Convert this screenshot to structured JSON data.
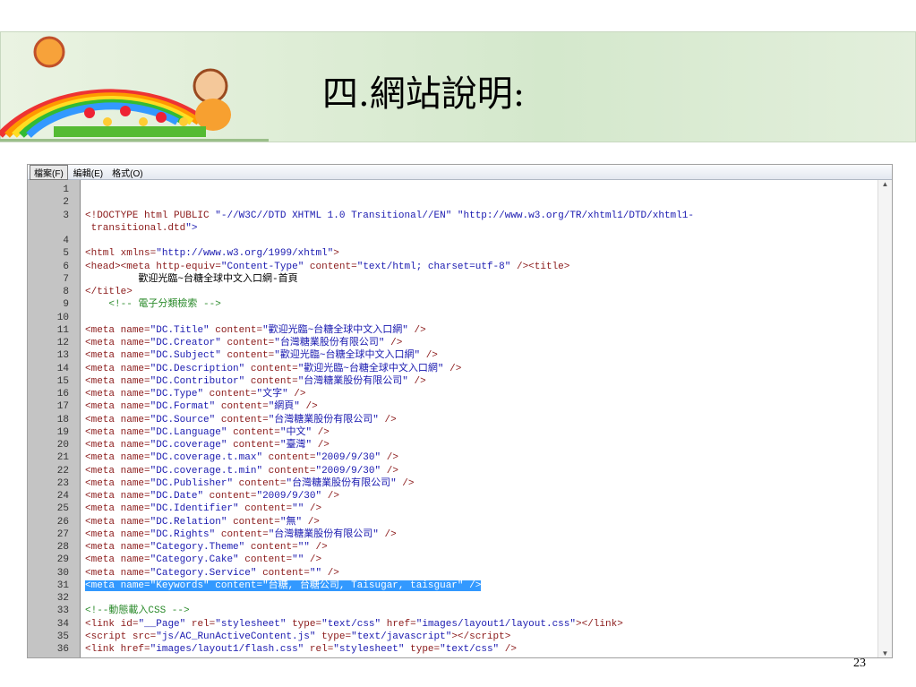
{
  "slide": {
    "title": "四.網站說明:",
    "page_number": "23"
  },
  "editor": {
    "menu": [
      {
        "label": "檔案(F)"
      },
      {
        "label": "編輯(E)"
      },
      {
        "label": "格式(O)"
      }
    ],
    "selected_line": "31",
    "lines": [
      {
        "n": "1",
        "t": ""
      },
      {
        "n": "2",
        "t": ""
      },
      {
        "n": "3",
        "t": "<!DOCTYPE html PUBLIC \"-//W3C//DTD XHTML 1.0 Transitional//EN\" \"http://www.w3.org/TR/xhtml1/DTD/xhtml1-"
      },
      {
        "n": "",
        "t": " transitional.dtd\">"
      },
      {
        "n": "4",
        "t": ""
      },
      {
        "n": "5",
        "t": "<html xmlns=\"http://www.w3.org/1999/xhtml\">"
      },
      {
        "n": "6",
        "t": "<head><meta http-equiv=\"Content-Type\" content=\"text/html; charset=utf-8\" /><title>"
      },
      {
        "n": "7",
        "t": "         歡迎光臨~台糖全球中文入口網-首頁"
      },
      {
        "n": "8",
        "t": "</title>"
      },
      {
        "n": "9",
        "t": "    <!-- 電子分類檢索 -->"
      },
      {
        "n": "10",
        "t": ""
      },
      {
        "n": "11",
        "t": "<meta name=\"DC.Title\" content=\"歡迎光臨~台糖全球中文入口網\" />"
      },
      {
        "n": "12",
        "t": "<meta name=\"DC.Creator\" content=\"台灣糖業股份有限公司\" />"
      },
      {
        "n": "13",
        "t": "<meta name=\"DC.Subject\" content=\"歡迎光臨~台糖全球中文入口網\" />"
      },
      {
        "n": "14",
        "t": "<meta name=\"DC.Description\" content=\"歡迎光臨~台糖全球中文入口網\" />"
      },
      {
        "n": "15",
        "t": "<meta name=\"DC.Contributor\" content=\"台灣糖業股份有限公司\" />"
      },
      {
        "n": "16",
        "t": "<meta name=\"DC.Type\" content=\"文字\" />"
      },
      {
        "n": "17",
        "t": "<meta name=\"DC.Format\" content=\"網頁\" />"
      },
      {
        "n": "18",
        "t": "<meta name=\"DC.Source\" content=\"台灣糖業股份有限公司\" />"
      },
      {
        "n": "19",
        "t": "<meta name=\"DC.Language\" content=\"中文\" />"
      },
      {
        "n": "20",
        "t": "<meta name=\"DC.coverage\" content=\"臺灣\" />"
      },
      {
        "n": "21",
        "t": "<meta name=\"DC.coverage.t.max\" content=\"2009/9/30\" />"
      },
      {
        "n": "22",
        "t": "<meta name=\"DC.coverage.t.min\" content=\"2009/9/30\" />"
      },
      {
        "n": "23",
        "t": "<meta name=\"DC.Publisher\" content=\"台灣糖業股份有限公司\" />"
      },
      {
        "n": "24",
        "t": "<meta name=\"DC.Date\" content=\"2009/9/30\" />"
      },
      {
        "n": "25",
        "t": "<meta name=\"DC.Identifier\" content=\"\" />"
      },
      {
        "n": "26",
        "t": "<meta name=\"DC.Relation\" content=\"無\" />"
      },
      {
        "n": "27",
        "t": "<meta name=\"DC.Rights\" content=\"台灣糖業股份有限公司\" />"
      },
      {
        "n": "28",
        "t": "<meta name=\"Category.Theme\" content=\"\" />"
      },
      {
        "n": "29",
        "t": "<meta name=\"Category.Cake\" content=\"\" />"
      },
      {
        "n": "30",
        "t": "<meta name=\"Category.Service\" content=\"\" />"
      },
      {
        "n": "31",
        "t": "<meta name=\"Keywords\" content=\"台糖, 台糖公司, Taisugar, taisguar\" />"
      },
      {
        "n": "32",
        "t": ""
      },
      {
        "n": "33",
        "t": "<!--動態載入CSS -->"
      },
      {
        "n": "34",
        "t": "<link id=\"__Page\" rel=\"stylesheet\" type=\"text/css\" href=\"images/layout1/layout.css\"></link>"
      },
      {
        "n": "35",
        "t": "<script src=\"js/AC_RunActiveContent.js\" type=\"text/javascript\"></script>"
      },
      {
        "n": "36",
        "t": "<link href=\"images/layout1/flash.css\" rel=\"stylesheet\" type=\"text/css\" />"
      }
    ]
  }
}
